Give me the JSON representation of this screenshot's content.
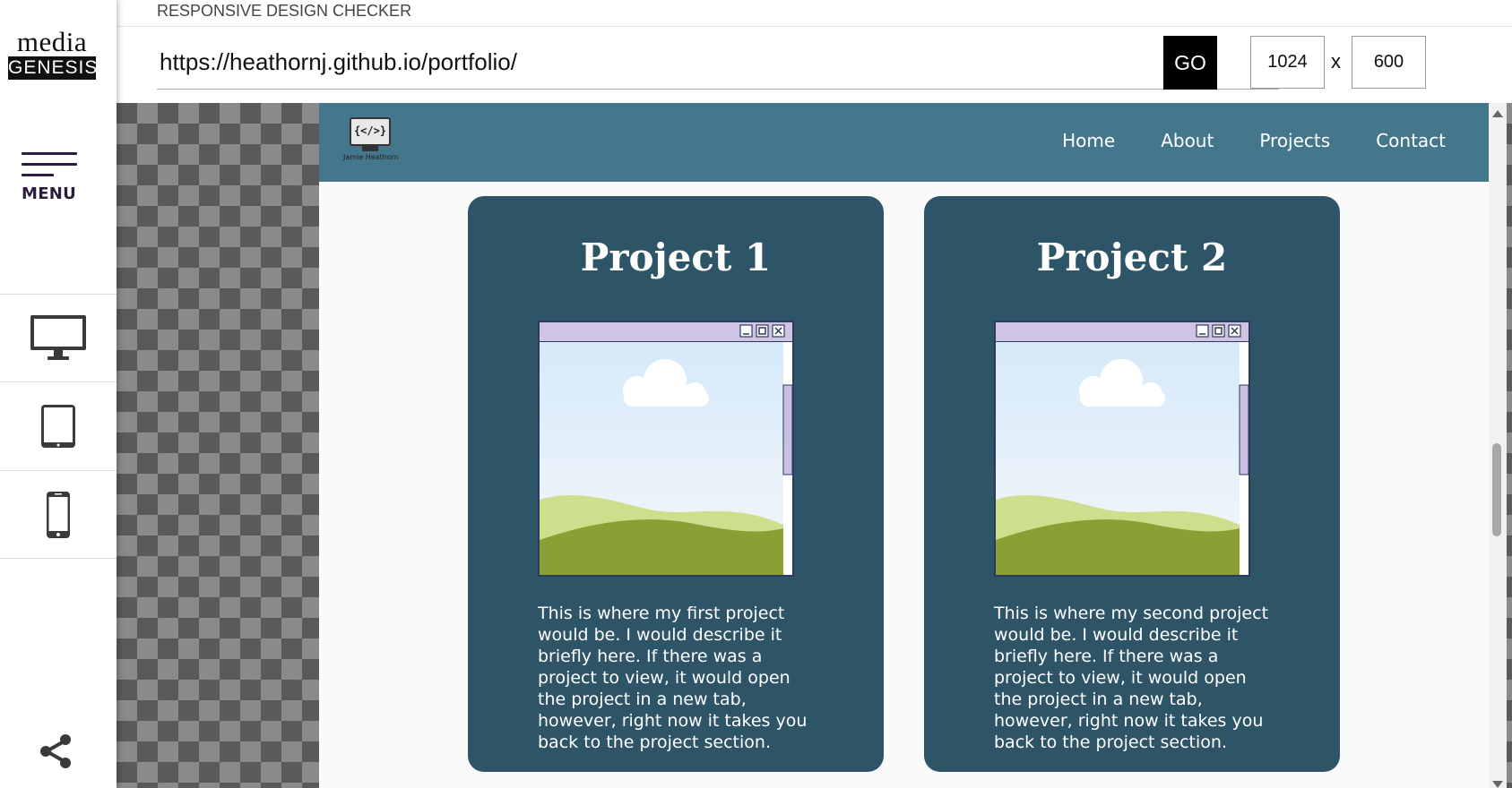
{
  "sidebar": {
    "logo_top": "media",
    "logo_bottom": "GENESIS",
    "menu_label": "MENU",
    "devices": [
      {
        "name": "desktop",
        "icon": "desktop-monitor-icon"
      },
      {
        "name": "tablet",
        "icon": "tablet-icon"
      },
      {
        "name": "phone",
        "icon": "phone-icon"
      }
    ],
    "share_icon": "share-icon"
  },
  "toolbar": {
    "title": "RESPONSIVE DESIGN CHECKER",
    "url": "https://heathornj.github.io/portfolio/",
    "go_label": "GO",
    "width": "1024",
    "separator": "x",
    "height": "600"
  },
  "site": {
    "logo_code": "{</>}",
    "logo_name": "Jamie Heathorn",
    "nav": [
      "Home",
      "About",
      "Projects",
      "Contact"
    ],
    "projects": [
      {
        "title": "Project 1",
        "description": "This is where my first project would be. I would describe it briefly here. If there was a project to view, it would open the project in a new tab, however, right now it takes you back to the project section."
      },
      {
        "title": "Project 2",
        "description": "This is where my second project would be. I would describe it briefly here. If there was a project to view, it would open the project in a new tab, however, right now it takes you back to the project section."
      }
    ]
  },
  "colors": {
    "nav_bg": "#44778b",
    "card_bg": "#2e5467",
    "window_bar": "#d0c4e6",
    "menu_color": "#2d1b3d"
  }
}
